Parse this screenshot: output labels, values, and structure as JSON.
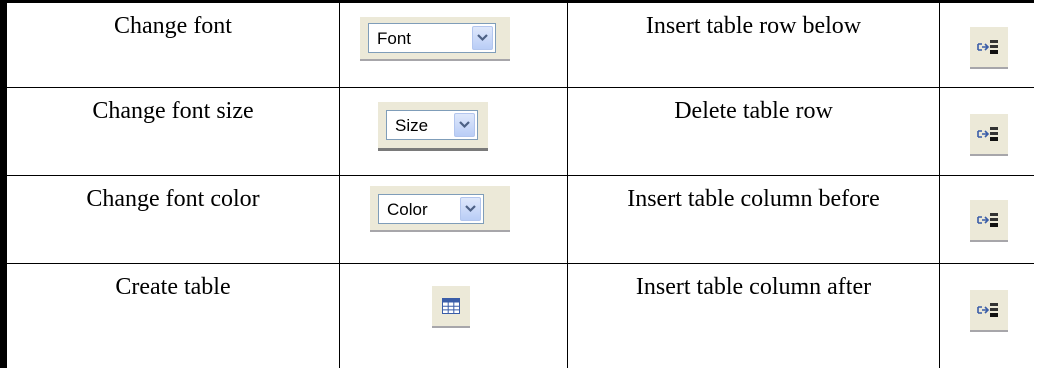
{
  "rows": [
    {
      "left_label": "Change font",
      "left_control": {
        "type": "dropdown",
        "value": "Font",
        "icon": "chevron-down-icon"
      },
      "right_label": "Insert table row below",
      "right_control": {
        "type": "icon-button",
        "icon": "insert-table-row-icon"
      }
    },
    {
      "left_label": "Change font size",
      "left_control": {
        "type": "dropdown",
        "value": "Size",
        "icon": "chevron-down-icon"
      },
      "right_label": "Delete table row",
      "right_control": {
        "type": "icon-button",
        "icon": "insert-table-row-icon"
      }
    },
    {
      "left_label": "Change font color",
      "left_control": {
        "type": "dropdown",
        "value": "Color",
        "icon": "chevron-down-icon"
      },
      "right_label": "Insert table column before",
      "right_control": {
        "type": "icon-button",
        "icon": "insert-table-row-icon"
      }
    },
    {
      "left_label": "Create table",
      "left_control": {
        "type": "icon-button",
        "icon": "table-grid-icon"
      },
      "right_label": "Insert table column after",
      "right_control": {
        "type": "icon-button",
        "icon": "insert-table-row-icon"
      }
    }
  ],
  "colors": {
    "toolbar_bg": "#ece9d8",
    "combo_border": "#7f9db9",
    "combo_button": "#c3d3fd",
    "arrow": "#4d6185",
    "icon_blue": "#3a5da8"
  }
}
